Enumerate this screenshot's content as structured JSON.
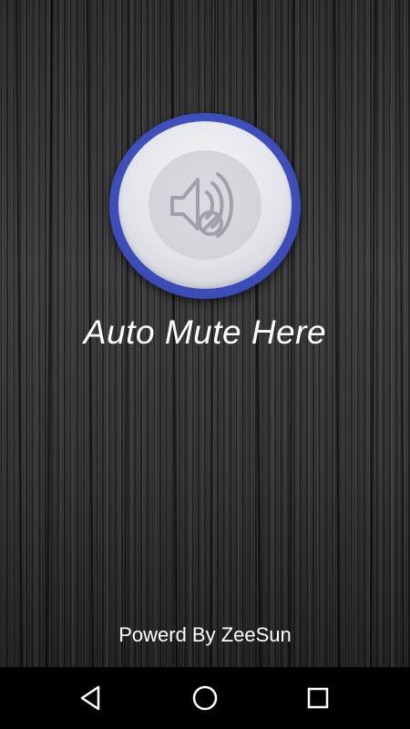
{
  "main": {
    "title": "Auto Mute Here",
    "credit": "Powerd By ZeeSun",
    "mute_button": {
      "icon": "speaker-mute-icon"
    }
  },
  "nav_bar": {
    "items": [
      {
        "icon": "back-triangle-icon"
      },
      {
        "icon": "home-circle-icon"
      },
      {
        "icon": "recents-square-icon"
      }
    ]
  },
  "colors": {
    "button_ring": "#3c4cb8",
    "button_face": "#e3e5ea",
    "icon_stroke": "#9ea1ab",
    "text": "#ffffff",
    "nav_background": "#000000"
  }
}
